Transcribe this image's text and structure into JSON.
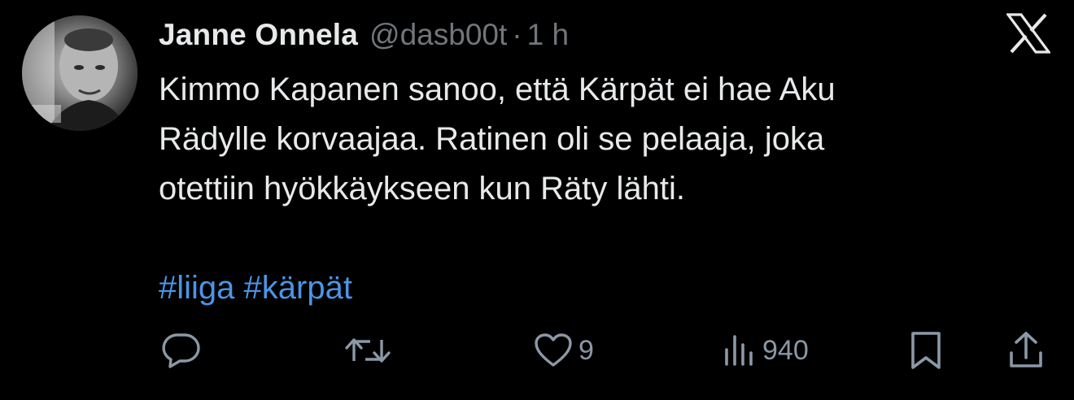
{
  "author": {
    "display_name": "Janne Onnela",
    "handle": "@dasb00t",
    "separator": "·",
    "time": "1 h",
    "avatar_icon": "profile-photo"
  },
  "platform": {
    "logo_icon": "x-logo"
  },
  "tweet": {
    "lines": [
      "Kimmo Kapanen sanoo, että Kärpät ei hae Aku",
      "Rädylle korvaajaa. Ratinen oli se pelaaja, joka",
      "otettiin hyökkäykseen kun Räty lähti."
    ],
    "hashtags": [
      "#liiga",
      "#kärpät"
    ]
  },
  "actions": {
    "reply": {
      "icon": "reply-icon",
      "count": ""
    },
    "retweet": {
      "icon": "retweet-icon",
      "count": ""
    },
    "like": {
      "icon": "heart-icon",
      "count": "9"
    },
    "views": {
      "icon": "views-icon",
      "count": "940"
    },
    "bookmark": {
      "icon": "bookmark-icon"
    },
    "share": {
      "icon": "share-icon"
    }
  },
  "colors": {
    "background": "#000000",
    "text": "#e7e9ea",
    "secondary": "#71767b",
    "link": "#4a95e6",
    "icon": "#8b98a5"
  }
}
